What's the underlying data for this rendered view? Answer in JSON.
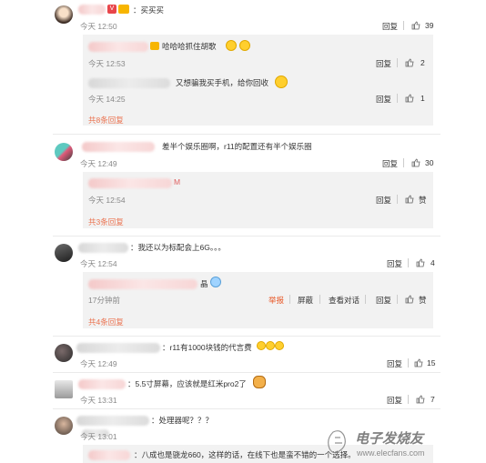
{
  "colors": {
    "accent": "#eb7350",
    "report": "#e85a2a",
    "time": "#888888",
    "reply_bg": "#f2f2f2"
  },
  "comments": [
    {
      "text": "：买买买",
      "time": "今天 12:50",
      "reply": "回复",
      "likes": "39"
    },
    {
      "text": "差半个娱乐圈啊，r11的配置还有半个娱乐圈",
      "time": "今天 12:49",
      "reply": "回复",
      "likes": "30"
    },
    {
      "text": "：我还以为标配会上6G。。。",
      "time": "今天 12:54",
      "reply": "回复",
      "likes": "4"
    },
    {
      "text": "：r11有1000块钱的代言费",
      "time": "今天 12:49",
      "reply": "回复",
      "likes": "15"
    },
    {
      "text": "：5.5寸屏幕，应该就是红米pro2了",
      "time": "今天 13:31",
      "reply": "回复",
      "likes": "7"
    },
    {
      "text": "：处理器呢？？？",
      "time": "今天 13:01"
    }
  ],
  "sub_replies": [
    {
      "text": "哈哈哈抓住胡歌",
      "time": "今天 12:53",
      "reply": "回复",
      "likes": "2"
    },
    {
      "text": "又想骗我买手机，给你回收",
      "time": "今天 14:25",
      "reply": "回复",
      "likes": "1"
    },
    {
      "text": "M",
      "time": "今天 12:54",
      "reply": "回复",
      "likes": "赞"
    },
    {
      "text": "晶",
      "time": "17分钟前",
      "report": "举报",
      "block": "屏蔽",
      "view": "查看对话",
      "reply": "回复",
      "likes": "赞"
    },
    {
      "text": "：八成也是骁龙660，这样的话，在线下也是蛮不错的一个选择。"
    }
  ],
  "more_links": [
    "共8条回复",
    "共3条回复",
    "共4条回复"
  ],
  "watermark": {
    "title": "电子发烧友",
    "url": "www.elecfans.com"
  }
}
